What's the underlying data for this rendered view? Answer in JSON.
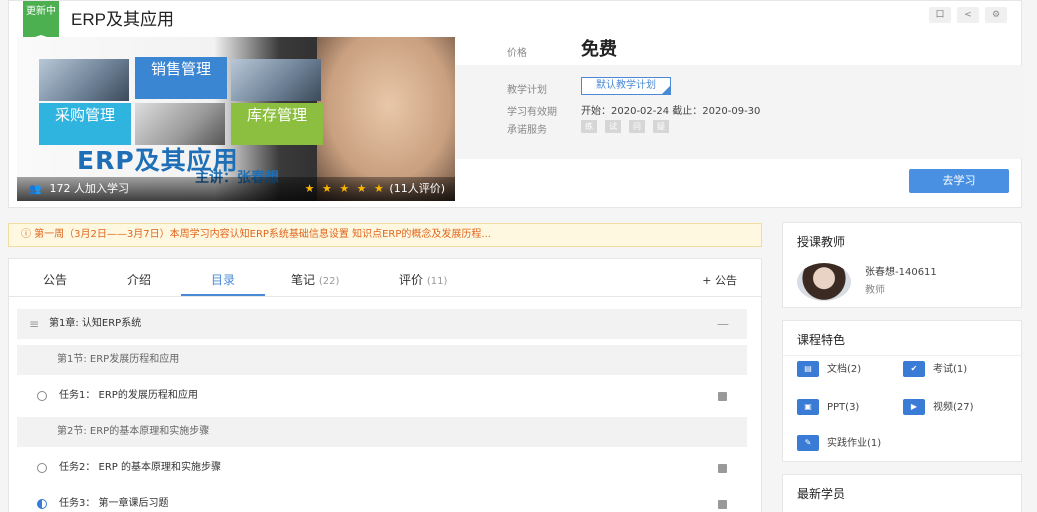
{
  "course": {
    "badge": "更新中",
    "title": "ERP及其应用",
    "tools": [
      "口",
      "<",
      "⚙"
    ],
    "cover": {
      "tiles": [
        "销售管理",
        "采购管理",
        "库存管理"
      ],
      "big_title": "ERP及其应用",
      "lecturer": "主讲：张春想",
      "learners": "172 人加入学习",
      "stars": "★ ★ ★ ★ ★",
      "rating": "(11人评价)"
    },
    "price_label": "价格",
    "price": "免费",
    "plan_label": "教学计划",
    "plan_button": "默认教学计划",
    "validity_label": "学习有效期",
    "validity": "开始：2020-02-24   截止：2020-09-30",
    "service_label": "承诺服务",
    "services": [
      "练",
      "试",
      "问",
      "疑"
    ],
    "study_button": "去学习"
  },
  "notice": "ⓘ 第一周（3月2日——3月7日）本周学习内容认知ERP系统基础信息设置 知识点ERP的概念及发展历程...",
  "tabs": [
    {
      "label": "公告",
      "count": ""
    },
    {
      "label": "介绍",
      "count": ""
    },
    {
      "label": "目录",
      "count": ""
    },
    {
      "label": "笔记",
      "count": "(22)"
    },
    {
      "label": "评价",
      "count": "(11)"
    }
  ],
  "add_notice": "+ 公告",
  "catalog": {
    "chapter": "第1章: 认知ERP系统",
    "chapter_toggle": "—",
    "section1": "第1节: ERP发展历程和应用",
    "task1": "任务1：  ERP的发展历程和应用",
    "section2": "第2节: ERP的基本原理和实施步骤",
    "task2": "任务2：  ERP 的基本原理和实施步骤",
    "task3": "任务3：  第一章课后习题"
  },
  "teacher_panel": {
    "title": "授课教师",
    "name": "张春想-140611",
    "role": "教师"
  },
  "features_panel": {
    "title": "课程特色",
    "items": [
      "文档(2)",
      "考试(1)",
      "PPT(3)",
      "视频(27)",
      "实践作业(1)"
    ]
  },
  "students_panel": {
    "title": "最新学员"
  },
  "colors": {
    "accent": "#4a8ad4",
    "badge": "#4caf50",
    "notice_text": "#e0651d"
  }
}
